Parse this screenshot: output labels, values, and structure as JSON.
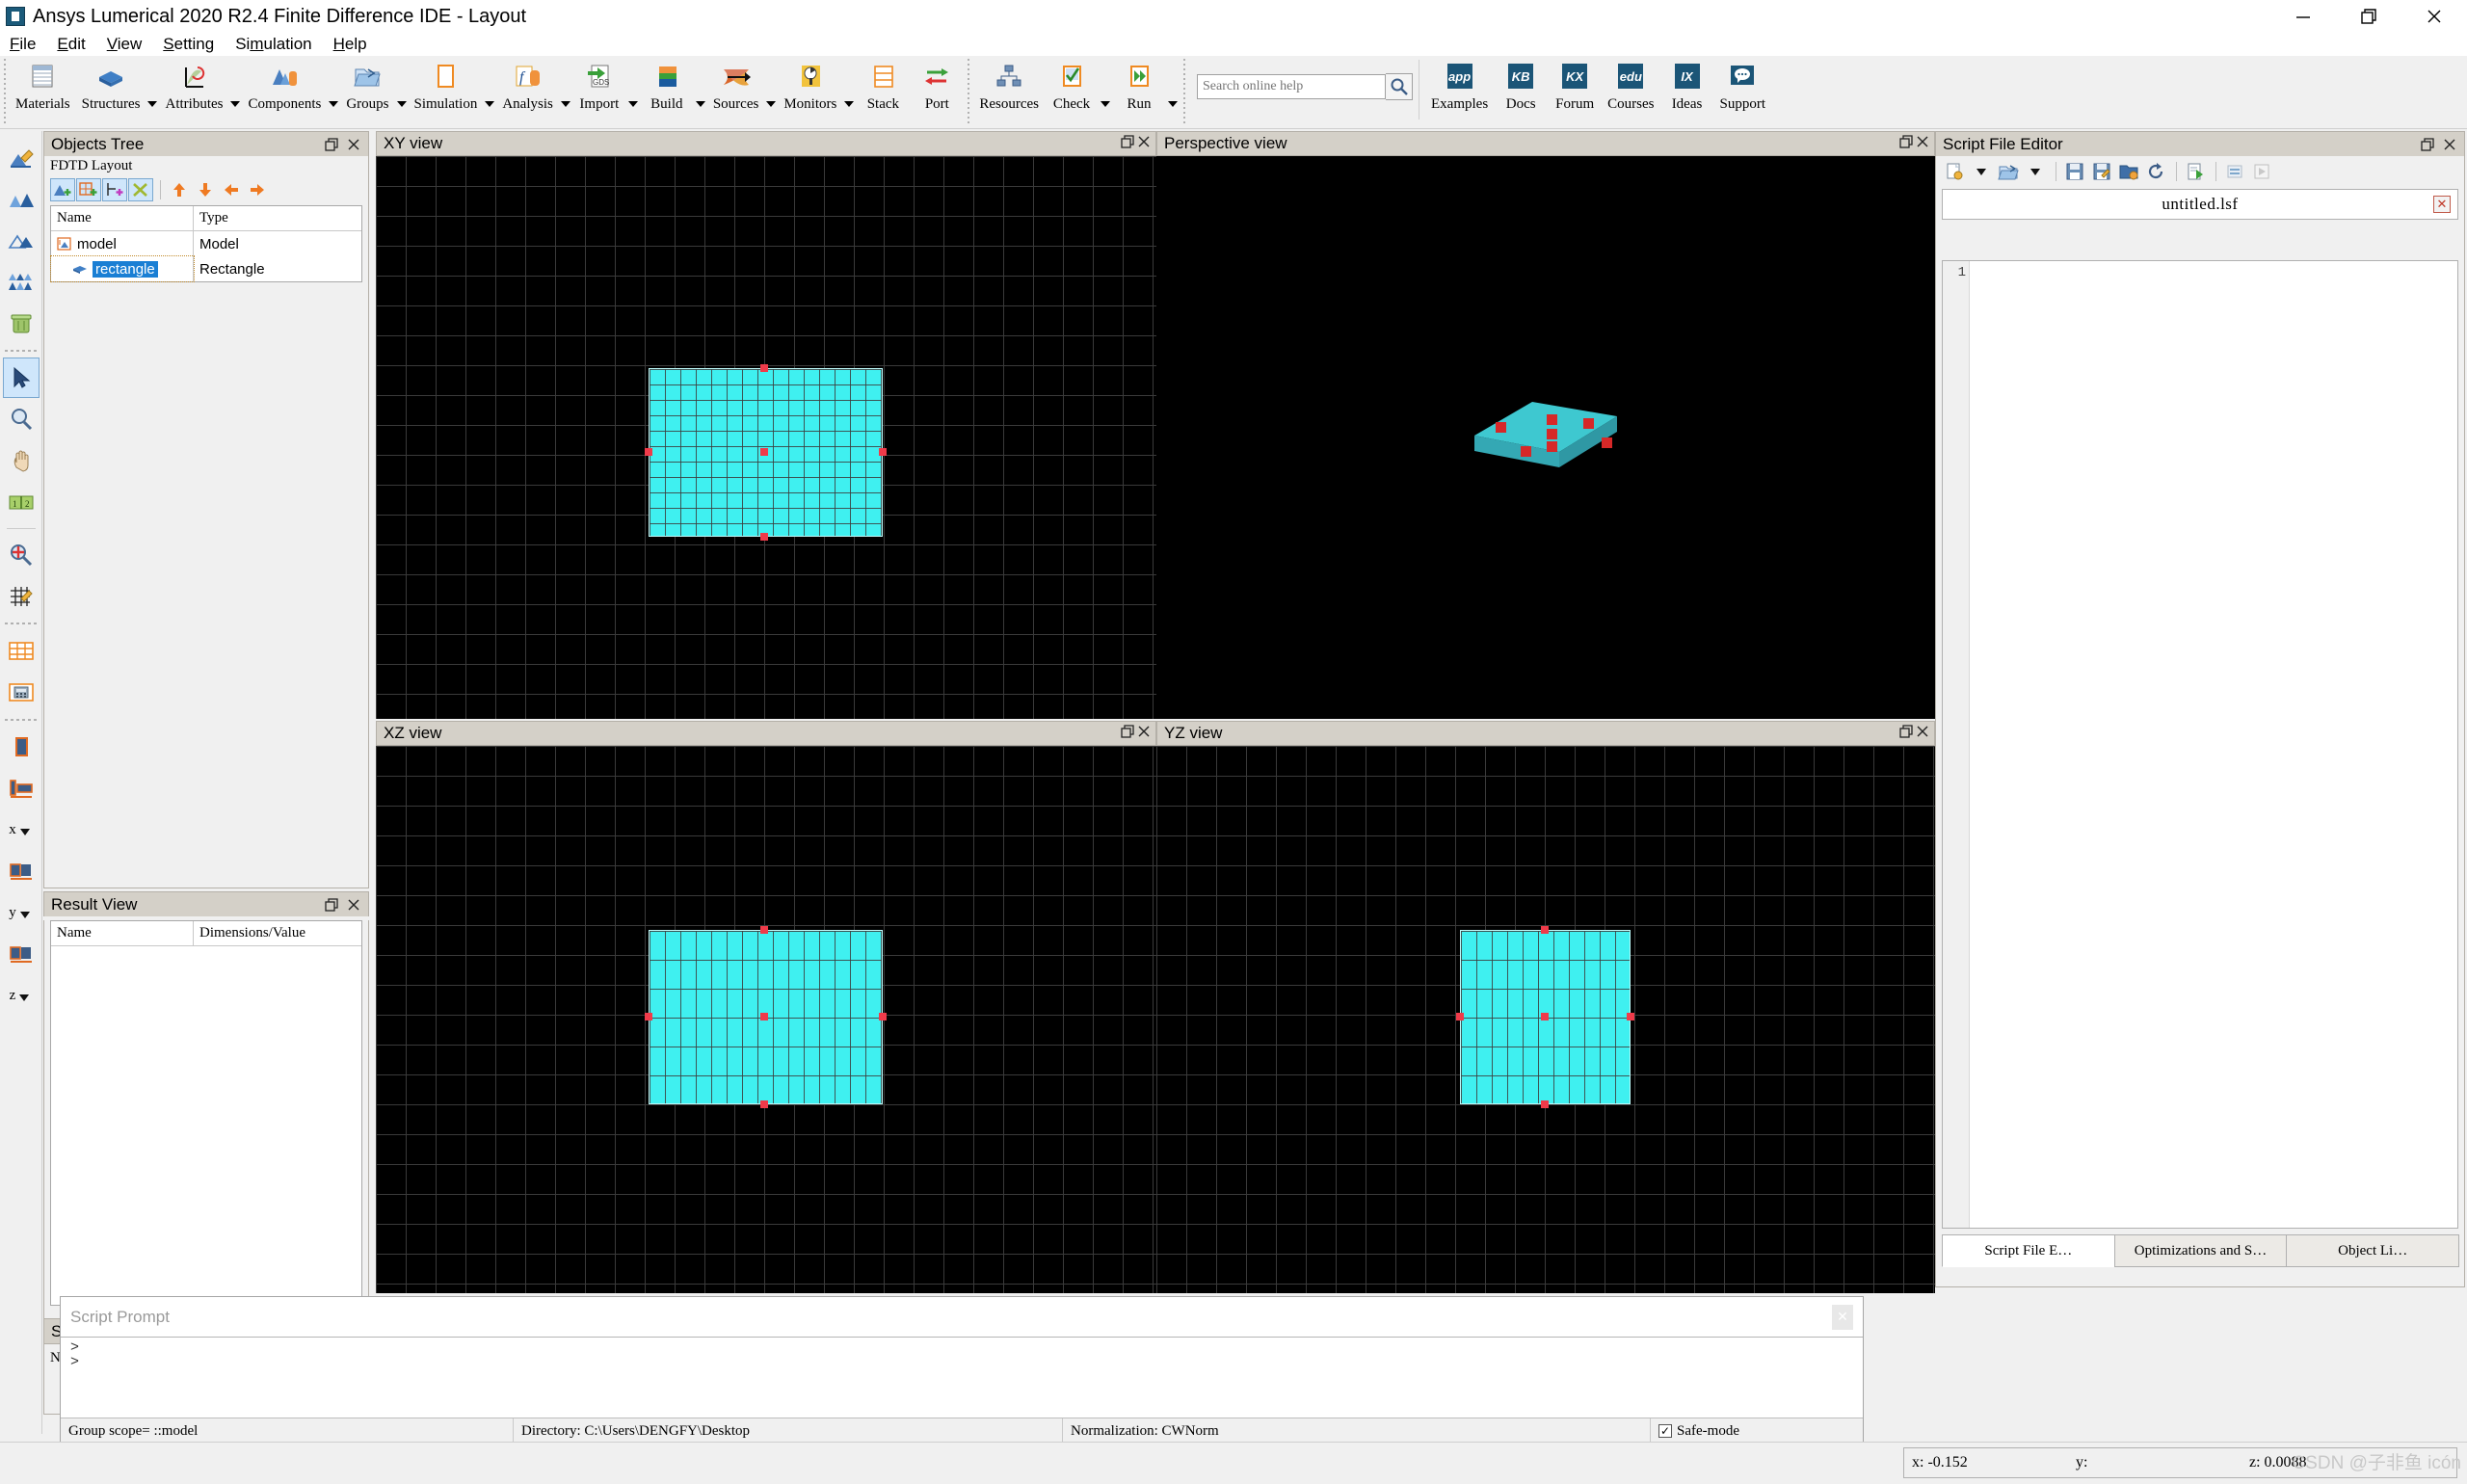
{
  "window": {
    "title": "Ansys Lumerical 2020 R2.4 Finite Difference IDE - Layout",
    "app_icon": "app-window-icon",
    "minimize": "minimize-icon",
    "restore": "restore-icon",
    "close": "close-icon"
  },
  "menubar": {
    "items": [
      {
        "label": "File"
      },
      {
        "label": "Edit"
      },
      {
        "label": "View"
      },
      {
        "label": "Setting"
      },
      {
        "label": "Simulation"
      },
      {
        "label": "Help"
      }
    ]
  },
  "ribbon": {
    "groups": [
      {
        "buttons": [
          {
            "label": "Materials",
            "icon": "materials-table-icon",
            "arrow": false
          },
          {
            "label": "Structures",
            "icon": "blue-box-icon",
            "arrow": true
          },
          {
            "label": "Attributes",
            "icon": "attributes-curve-icon",
            "arrow": true
          },
          {
            "label": "Components",
            "icon": "components-icon",
            "arrow": true
          },
          {
            "label": "Groups",
            "icon": "folder-group-icon",
            "arrow": true
          },
          {
            "label": "Simulation",
            "icon": "simulation-region-icon",
            "arrow": true
          },
          {
            "label": "Analysis",
            "icon": "analysis-fx-icon",
            "arrow": true
          },
          {
            "label": "Import",
            "icon": "gds-import-icon",
            "arrow": true
          },
          {
            "label": "Build",
            "icon": "build-stack-icon",
            "arrow": true
          },
          {
            "label": "Sources",
            "icon": "sources-wave-icon",
            "arrow": true
          },
          {
            "label": "Monitors",
            "icon": "monitors-gauge-icon",
            "arrow": true
          },
          {
            "label": "Stack",
            "icon": "stack-layers-icon",
            "arrow": false
          },
          {
            "label": "Port",
            "icon": "port-arrows-icon",
            "arrow": false
          }
        ]
      },
      {
        "buttons": [
          {
            "label": "Resources",
            "icon": "resources-network-icon",
            "arrow": false
          },
          {
            "label": "Check",
            "icon": "check-clipboard-icon",
            "arrow": true
          },
          {
            "label": "Run",
            "icon": "run-play-icon",
            "arrow": true
          }
        ]
      },
      {
        "search": {
          "placeholder": "Search online help",
          "value": "",
          "go_icon": "search-icon"
        }
      },
      {
        "buttons": [
          {
            "label": "Examples",
            "icon": "app-badge-icon",
            "badge": "app",
            "arrow": false
          },
          {
            "label": "Docs",
            "icon": "kb-badge-icon",
            "badge": "KB",
            "arrow": false
          },
          {
            "label": "Forum",
            "icon": "kx-badge-icon",
            "badge": "KX",
            "arrow": false
          },
          {
            "label": "Courses",
            "icon": "edu-badge-icon",
            "badge": "edu",
            "arrow": false
          },
          {
            "label": "Ideas",
            "icon": "ix-badge-icon",
            "badge": "IX",
            "arrow": false
          },
          {
            "label": "Support",
            "icon": "support-chat-icon",
            "badge": "",
            "arrow": false
          }
        ]
      }
    ]
  },
  "left_toolbar": {
    "items": [
      {
        "icon": "edit-object-icon",
        "selected": false
      },
      {
        "icon": "two-objects-icon",
        "selected": false
      },
      {
        "icon": "select-object-icon",
        "selected": false
      },
      {
        "icon": "select-all-objects-icon",
        "selected": false
      },
      {
        "icon": "delete-trash-icon",
        "selected": false
      },
      {
        "icon": "arrow-select-cursor-icon",
        "selected": true
      },
      {
        "icon": "zoom-magnifier-icon",
        "selected": false
      },
      {
        "icon": "pan-hand-icon",
        "selected": false
      },
      {
        "icon": "measure-ruler-icon",
        "selected": false
      },
      {
        "icon": "zoom-extent-icon",
        "selected": false
      },
      {
        "icon": "edit-mesh-icon",
        "selected": false
      },
      {
        "icon": "mesh-grid-icon",
        "selected": false
      },
      {
        "icon": "mesh-calc-icon",
        "selected": false
      },
      {
        "icon": "view-single-icon",
        "selected": false
      },
      {
        "icon": "view-split-icon",
        "selected": false
      },
      {
        "icon": "axis-x-icon",
        "label": "x",
        "selected": false
      },
      {
        "icon": "view-x-split-icon",
        "selected": false
      },
      {
        "icon": "axis-y-icon",
        "label": "y",
        "selected": false
      },
      {
        "icon": "view-y-split-icon",
        "selected": false
      },
      {
        "icon": "axis-z-icon",
        "label": "z",
        "selected": false
      }
    ]
  },
  "objects_tree": {
    "title": "Objects Tree",
    "float_icon": "float-panel-icon",
    "close_icon": "close-panel-icon",
    "scope_label": "FDTD  Layout",
    "toolbar": [
      {
        "icon": "add-object-icon",
        "on": true
      },
      {
        "icon": "add-group-icon",
        "on": true
      },
      {
        "icon": "add-mesh-icon",
        "on": true
      },
      {
        "icon": "delete-object-icon",
        "on": true
      },
      {
        "icon": "move-up-icon",
        "on": false
      },
      {
        "icon": "move-down-icon",
        "on": false
      },
      {
        "icon": "move-left-icon",
        "on": false
      },
      {
        "icon": "move-right-icon",
        "on": false
      }
    ],
    "columns": [
      "Name",
      "Type"
    ],
    "rows": [
      {
        "name": "model",
        "type": "Model",
        "icon": "model-icon",
        "indent": 0,
        "selected": false
      },
      {
        "name": "rectangle",
        "type": "Rectangle",
        "icon": "rectangle-object-icon",
        "indent": 1,
        "selected": true
      }
    ]
  },
  "result_view": {
    "title": "Result View",
    "float_icon": "float-panel-icon",
    "close_icon": "close-panel-icon",
    "columns": [
      "Name",
      "Dimensions/Value"
    ],
    "rows": []
  },
  "viewports": [
    {
      "id": "xy",
      "title": "XY view",
      "float_icon": "float-panel-icon",
      "close_icon": "close-panel-icon"
    },
    {
      "id": "perspective",
      "title": "Perspective view",
      "float_icon": "float-panel-icon",
      "close_icon": "close-panel-icon"
    },
    {
      "id": "xz",
      "title": "XZ view",
      "float_icon": "float-panel-icon",
      "close_icon": "close-panel-icon"
    },
    {
      "id": "yz",
      "title": "YZ view",
      "float_icon": "float-panel-icon",
      "close_icon": "close-panel-icon"
    }
  ],
  "script_editor": {
    "title": "Script File Editor",
    "float_icon": "float-panel-icon",
    "close_icon": "close-panel-icon",
    "toolbar": [
      {
        "icon": "new-script-icon",
        "arrow": true
      },
      {
        "icon": "open-script-icon",
        "arrow": true
      },
      {
        "icon": "save-script-icon",
        "arrow": false
      },
      {
        "icon": "save-as-script-icon",
        "arrow": false
      },
      {
        "icon": "save-all-icon",
        "arrow": false
      },
      {
        "icon": "reload-icon",
        "arrow": false
      },
      {
        "icon": "run-script-icon",
        "arrow": false
      },
      {
        "icon": "run-selection-icon",
        "arrow": false
      },
      {
        "icon": "step-icon",
        "arrow": false
      }
    ],
    "open_file": "untitled.lsf",
    "tab_close_icon": "close-tab-icon",
    "line_numbers": [
      "1"
    ],
    "code": "",
    "bottom_tabs": [
      {
        "label": "Script File E…",
        "active": true
      },
      {
        "label": "Optimizations and S…",
        "active": false
      },
      {
        "label": "Object Li…",
        "active": false
      }
    ]
  },
  "script_prompt": {
    "placeholder": "Script Prompt",
    "value": "",
    "clear_icon": "clear-input-icon",
    "output_lines": [
      ">",
      ">"
    ],
    "status": {
      "group_scope": "Group scope= ::model",
      "directory": "Directory: C:\\Users\\DENGFY\\Desktop",
      "normalization": "Normalization: CWNorm",
      "safe_mode_label": "Safe-mode",
      "safe_mode_checked": true,
      "safe_mode_check_glyph": "✓"
    }
  },
  "behind_panel": {
    "title": "Sc…",
    "column": "Na…"
  },
  "status_bar": {
    "x_label": "x:",
    "x_value": "-0.152",
    "y_label": "y:",
    "y_value": "",
    "z_label": "z:",
    "z_value": "0.0088",
    "watermark": "CSDN @子非鱼 icón"
  },
  "colors": {
    "shape_fill": "#3ff0f0",
    "shape_edge": "#bffbfb",
    "handle": "#ef3b4a",
    "canvas_bg": "#000000",
    "selection_blue": "#1a7fd4",
    "panel_head": "#d4d0c8"
  }
}
